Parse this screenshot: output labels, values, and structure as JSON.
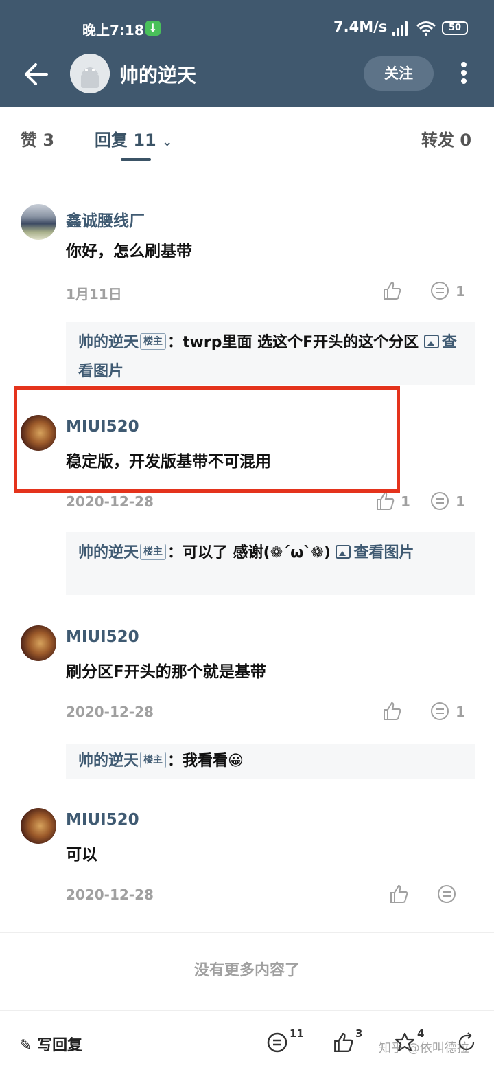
{
  "status": {
    "time": "晚上7:18",
    "speed": "7.4M/s",
    "battery": "50"
  },
  "header": {
    "title": "帅的逆天",
    "follow": "关注"
  },
  "tabs": {
    "likes": "赞 3",
    "replies": "回复 11",
    "forwards": "转发 0"
  },
  "comments": [
    {
      "author": "鑫诚腰线厂",
      "content": "你好，怎么刷基带",
      "date": "1月11日",
      "reply_count": "1",
      "reply": {
        "author": "帅的逆天",
        "tag": "楼主",
        "text": "：twrp里面 选这个F开头的这个分区",
        "link": "查看图片"
      }
    },
    {
      "author": "MIUI520",
      "content": "稳定版，开发版基带不可混用",
      "date": "2020-12-28",
      "like_count": "1",
      "reply_count": "1",
      "reply": {
        "author": "帅的逆天",
        "tag": "楼主",
        "text": "：可以了 感谢(❁´ω`❁)",
        "link": "查看图片"
      }
    },
    {
      "author": "MIUI520",
      "content": "刷分区F开头的那个就是基带",
      "date": "2020-12-28",
      "reply_count": "1",
      "reply": {
        "author": "帅的逆天",
        "tag": "楼主",
        "text": "：我看看😀"
      }
    },
    {
      "author": "MIUI520",
      "content": "可以",
      "date": "2020-12-28"
    }
  ],
  "no_more": "没有更多内容了",
  "bottom": {
    "write": "写回复",
    "comments": "11",
    "likes": "3",
    "stars": "4",
    "watermark": "知乎 @依叫德拉"
  },
  "colors": {
    "header_bg": "#40586e",
    "accent": "#3f5a72",
    "highlight": "#e4331c"
  }
}
